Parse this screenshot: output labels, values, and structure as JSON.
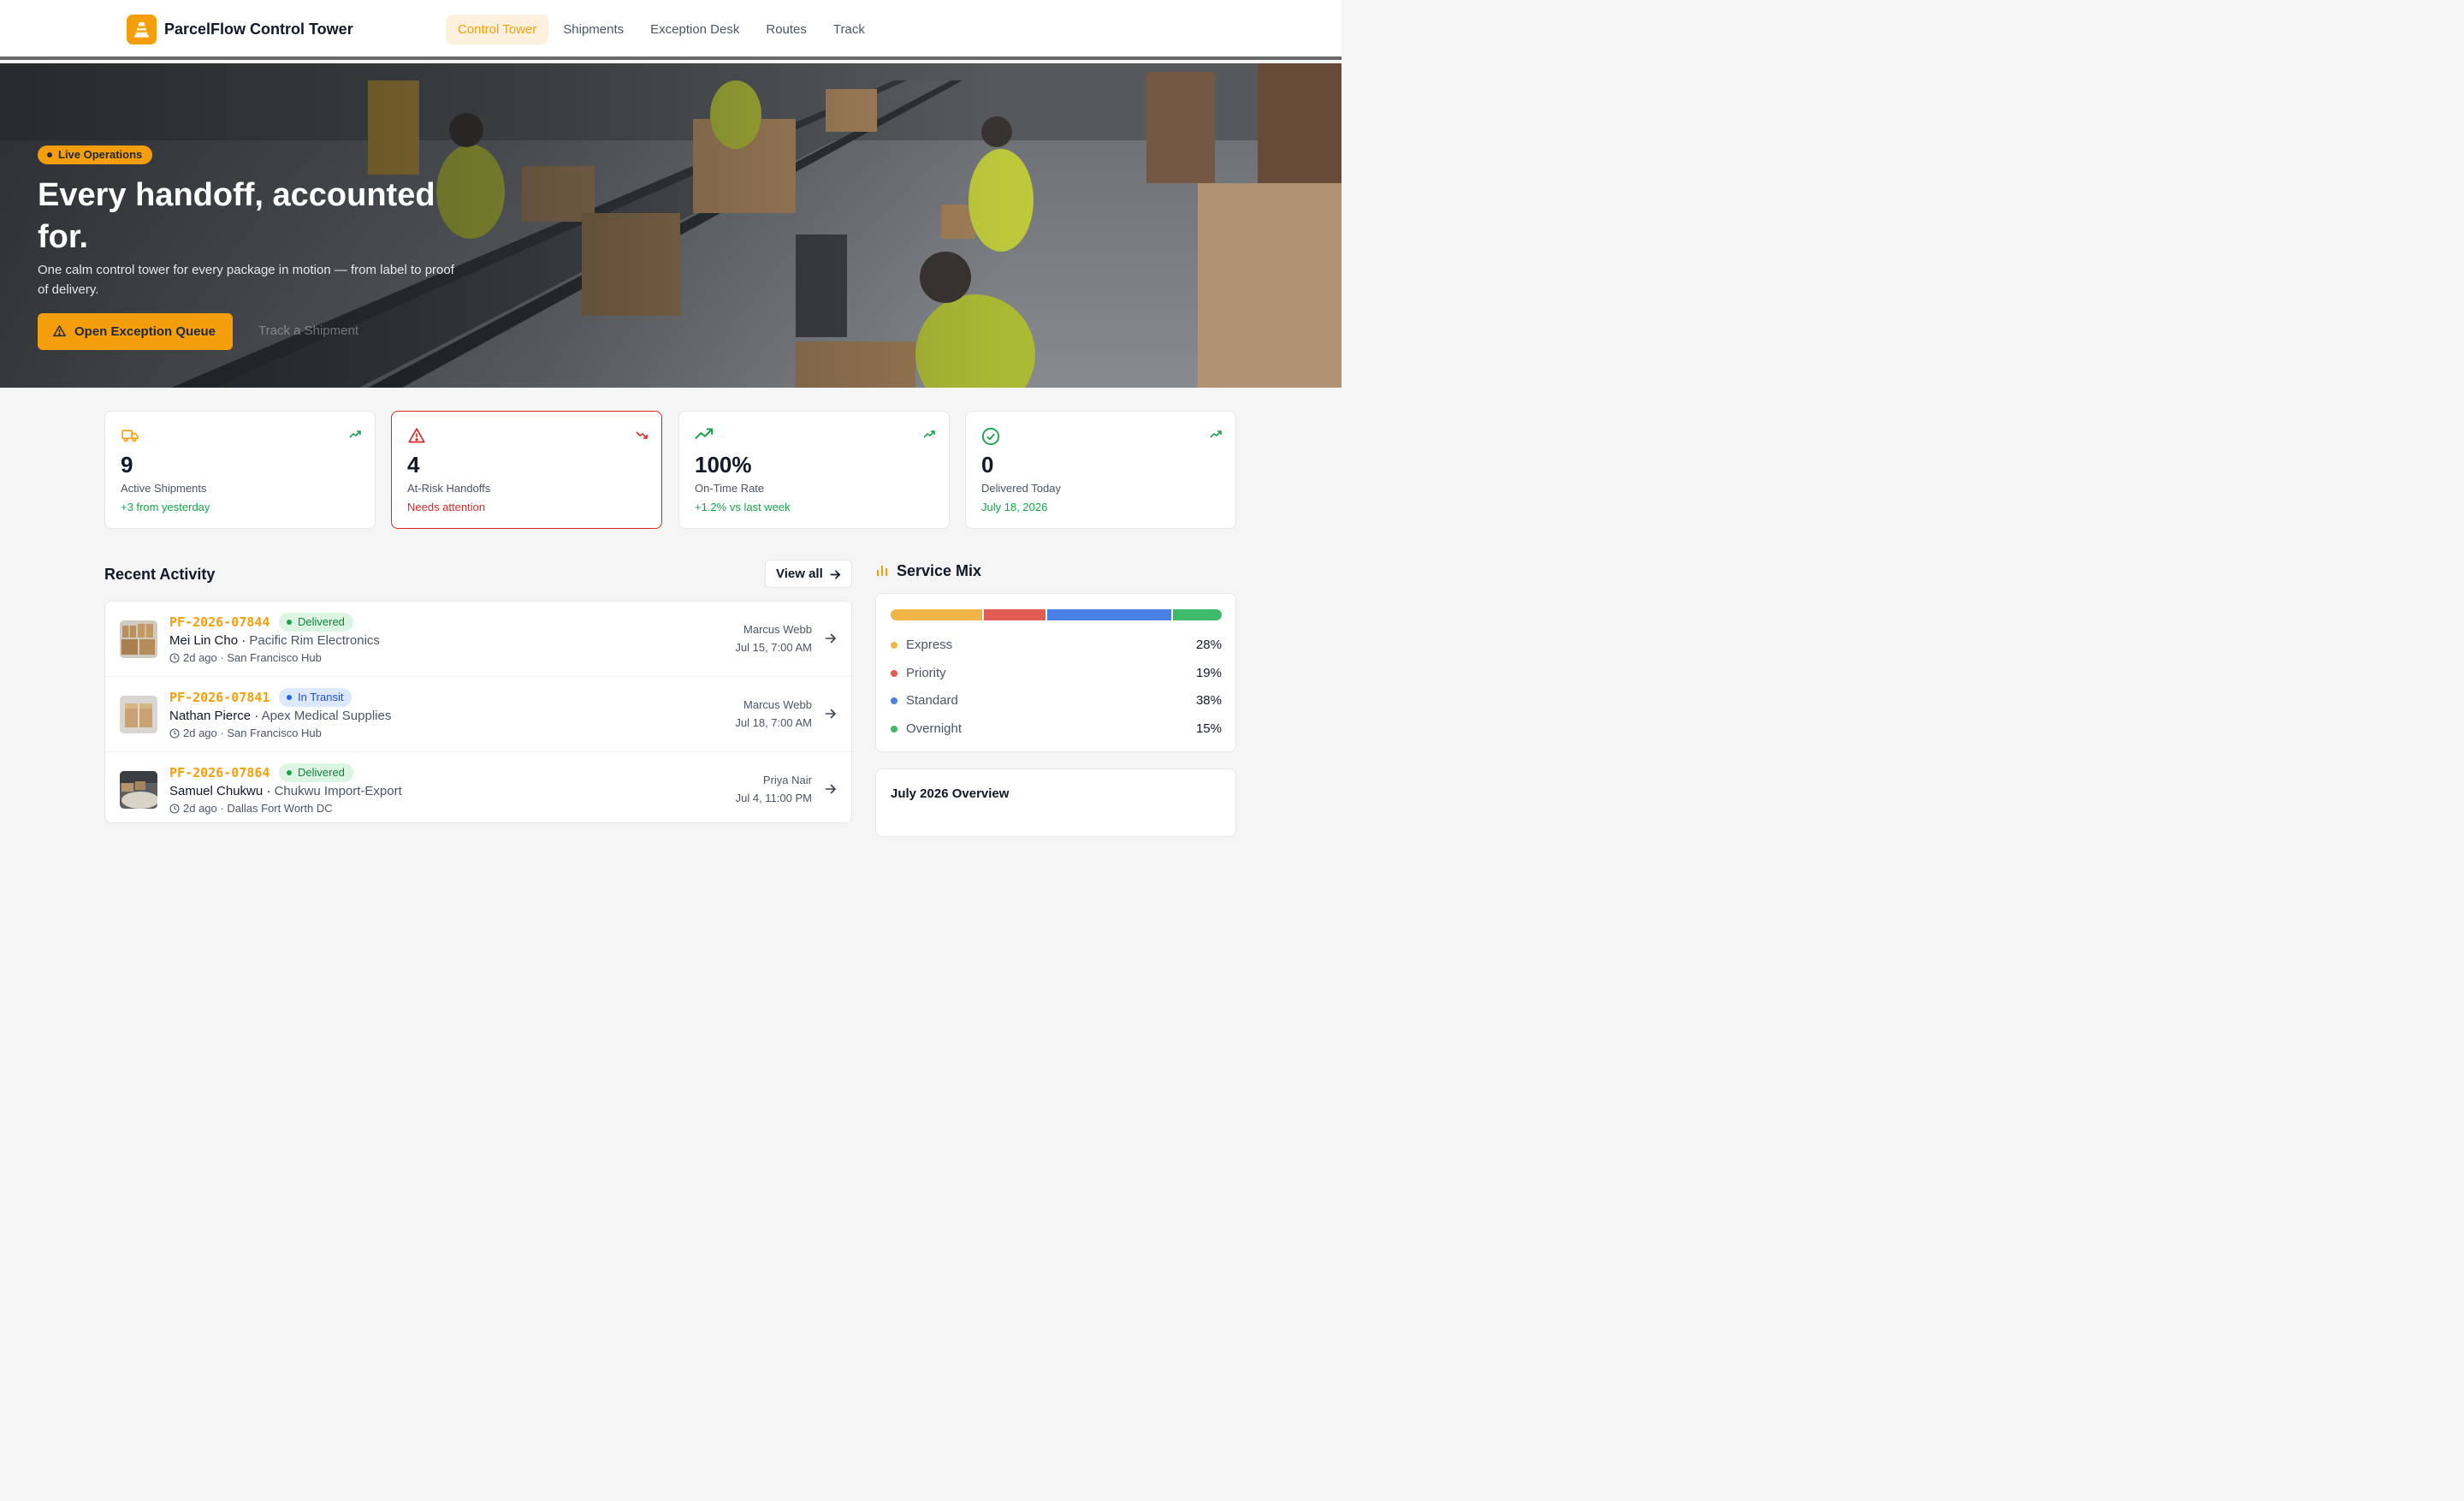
{
  "app": {
    "name": "ParcelFlow Control Tower",
    "accent": "#f59e0b"
  },
  "nav": [
    {
      "label": "Control Tower",
      "active": true
    },
    {
      "label": "Shipments",
      "active": false
    },
    {
      "label": "Exception Desk",
      "active": false
    },
    {
      "label": "Routes",
      "active": false
    },
    {
      "label": "Track",
      "active": false
    }
  ],
  "hero": {
    "badge": "Live Operations",
    "title": "Every handoff, accounted for.",
    "subtitle": "One calm control tower for every package in motion — from label to proof of delivery.",
    "primary_button": "Open Exception Queue",
    "secondary_button": "Track a Shipment"
  },
  "kpis": [
    {
      "icon": "truck-icon",
      "value": "9",
      "label": "Active Shipments",
      "sub": "+3 from yesterday",
      "trend": "up",
      "color": "#f59e0b"
    },
    {
      "icon": "warning-icon",
      "value": "4",
      "label": "At-Risk Handoffs",
      "sub": "Needs attention",
      "trend": "down",
      "color": "#dc2626"
    },
    {
      "icon": "trending-up-icon",
      "value": "100%",
      "label": "On-Time Rate",
      "sub": "+1.2% vs last week",
      "trend": "up",
      "color": "#16a34a"
    },
    {
      "icon": "check-circle-icon",
      "value": "0",
      "label": "Delivered Today",
      "sub": "July 18, 2026",
      "trend": "up",
      "color": "#16a34a"
    }
  ],
  "recent_activity": {
    "title": "Recent Activity",
    "view_all": "View all",
    "rows": [
      {
        "id": "PF-2026-07844",
        "status": "Delivered",
        "customer": "Mei Lin Cho",
        "company": "Pacific Rim Electronics",
        "ago": "2d ago",
        "hub": "San Francisco Hub",
        "agent": "Marcus Webb",
        "when": "Jul 15, 7:00 AM"
      },
      {
        "id": "PF-2026-07841",
        "status": "In Transit",
        "customer": "Nathan Pierce",
        "company": "Apex Medical Supplies",
        "ago": "2d ago",
        "hub": "San Francisco Hub",
        "agent": "Marcus Webb",
        "when": "Jul 18, 7:00 AM"
      },
      {
        "id": "PF-2026-07864",
        "status": "Delivered",
        "customer": "Samuel Chukwu",
        "company": "Chukwu Import-Export",
        "ago": "2d ago",
        "hub": "Dallas Fort Worth DC",
        "agent": "Priya Nair",
        "when": "Jul 4, 11:00 PM"
      }
    ]
  },
  "service_mix": {
    "title": "Service Mix",
    "items": [
      {
        "name": "Express",
        "pct": "28%",
        "value": 28,
        "color": "#f0b447"
      },
      {
        "name": "Priority",
        "pct": "19%",
        "value": 19,
        "color": "#e25c55"
      },
      {
        "name": "Standard",
        "pct": "38%",
        "value": 38,
        "color": "#4a7fe6"
      },
      {
        "name": "Overnight",
        "pct": "15%",
        "value": 15,
        "color": "#3fb96a"
      }
    ]
  },
  "overview": {
    "title": "July 2026 Overview"
  }
}
